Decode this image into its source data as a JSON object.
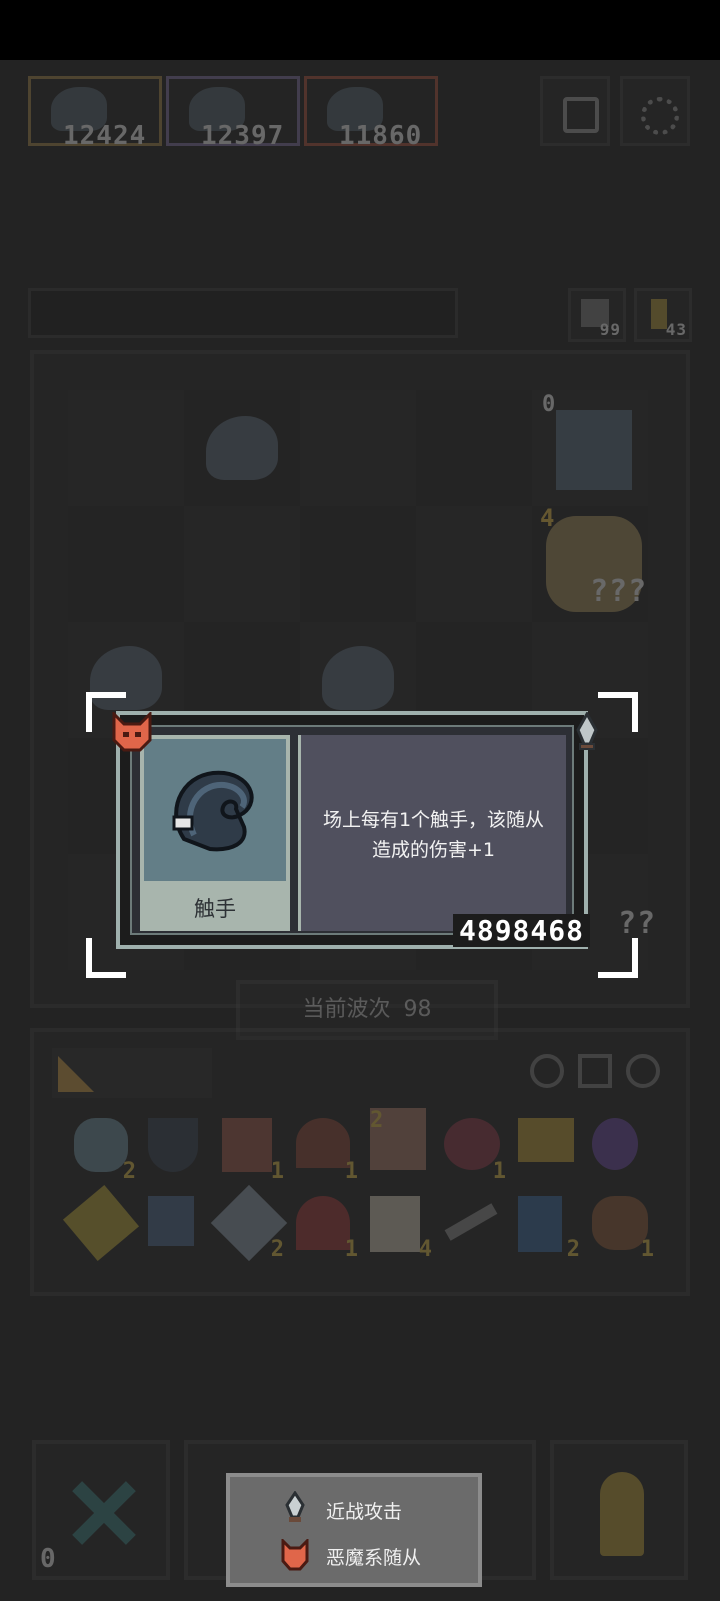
{
  "top_bar": {
    "players": [
      {
        "score": "12424"
      },
      {
        "score": "12397"
      },
      {
        "score": "11860"
      }
    ]
  },
  "board_side": {
    "counter_a": "99",
    "counter_b": "43"
  },
  "board": {
    "unit_left_level": "0",
    "unit_mid_level": "4",
    "unknown_label": "???",
    "unknown_label_2": "??"
  },
  "wave": {
    "label": "当前波次",
    "number": "98"
  },
  "inventory": {
    "row1": [
      {
        "icon": "heart-shield-icon",
        "qty": "2"
      },
      {
        "icon": "shield-icon",
        "qty": ""
      },
      {
        "icon": "drum-icon",
        "qty": "1"
      },
      {
        "icon": "helmet-icon",
        "qty": "1"
      },
      {
        "icon": "glove-icon",
        "qty": "2"
      },
      {
        "icon": "demon-mask-icon",
        "qty": "1"
      },
      {
        "icon": "crown-icon",
        "qty": ""
      },
      {
        "icon": "purple-swirl-icon",
        "qty": ""
      }
    ],
    "row2": [
      {
        "icon": "key-icon",
        "qty": ""
      },
      {
        "icon": "bird-icon",
        "qty": ""
      },
      {
        "icon": "axe-icon",
        "qty": "2"
      },
      {
        "icon": "hood-icon",
        "qty": "1"
      },
      {
        "icon": "scroll-icon",
        "qty": "4"
      },
      {
        "icon": "pickaxe-icon",
        "qty": ""
      },
      {
        "icon": "hourglass-icon",
        "qty": "2"
      },
      {
        "icon": "bag-icon",
        "qty": "1"
      }
    ]
  },
  "tooltip": {
    "name": "触手",
    "description_line1": "场上每有1个触手，该随从",
    "description_line2": "造成的伤害+1",
    "value": "4898468",
    "colors": {
      "frame": "#9fb0ad",
      "image_bg": "#637e87",
      "desc_bg": "#50505e"
    }
  },
  "bottom": {
    "cancel_count": "0"
  },
  "legend": {
    "items": [
      {
        "icon": "dagger-icon",
        "label": "近战攻击"
      },
      {
        "icon": "demon-icon",
        "label": "恶魔系随从"
      }
    ]
  }
}
